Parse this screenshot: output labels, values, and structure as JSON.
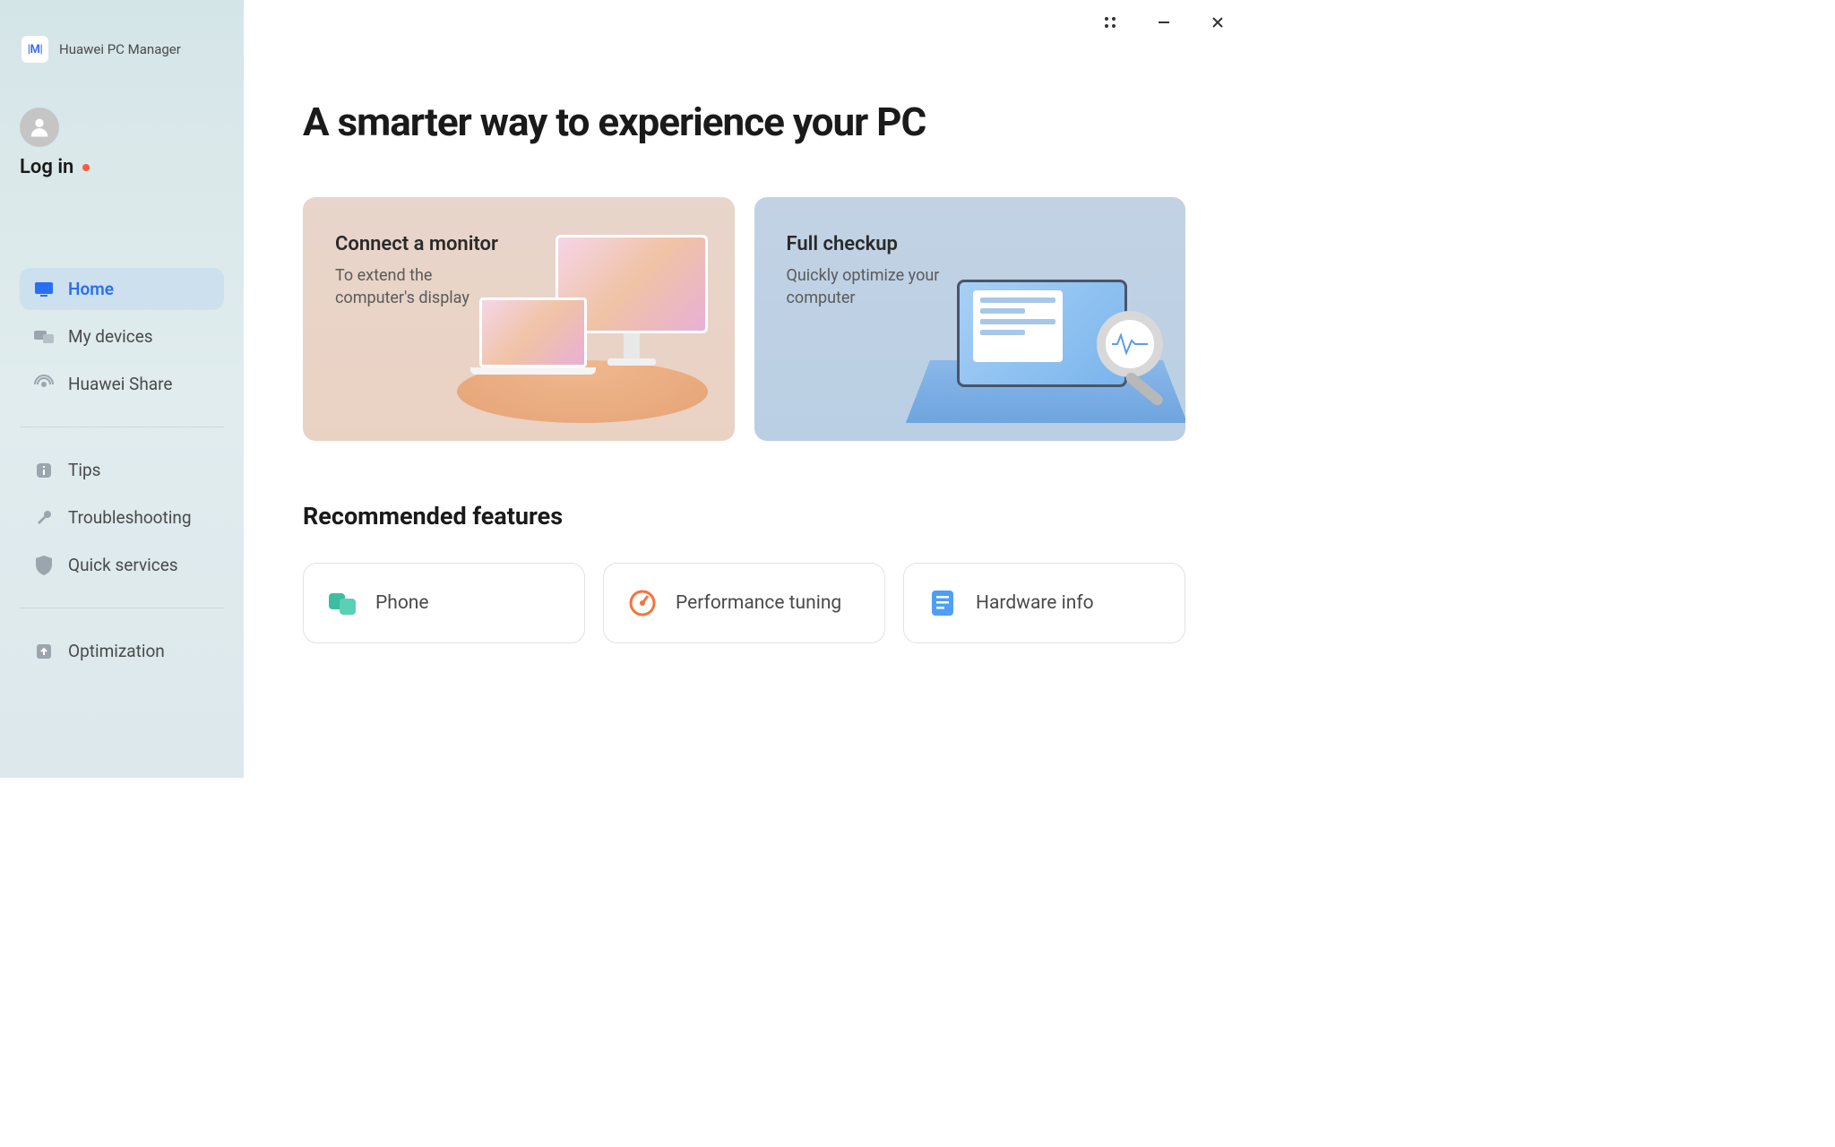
{
  "app": {
    "name": "Huawei PC Manager",
    "logo_text": "|M|"
  },
  "user": {
    "login_label": "Log in"
  },
  "sidebar": {
    "items_main": [
      {
        "label": "Home",
        "icon": "monitor-icon",
        "active": true
      },
      {
        "label": "My devices",
        "icon": "devices-icon",
        "active": false
      },
      {
        "label": "Huawei Share",
        "icon": "share-icon",
        "active": false
      }
    ],
    "items_support": [
      {
        "label": "Tips",
        "icon": "tips-icon"
      },
      {
        "label": "Troubleshooting",
        "icon": "wrench-icon"
      },
      {
        "label": "Quick services",
        "icon": "shield-icon"
      }
    ],
    "items_bottom": [
      {
        "label": "Optimization",
        "icon": "upload-icon"
      }
    ]
  },
  "main": {
    "page_title": "A smarter way to experience your PC",
    "cards": {
      "monitor": {
        "title": "Connect a monitor",
        "subtitle": "To extend the computer's display"
      },
      "checkup": {
        "title": "Full checkup",
        "subtitle": "Quickly optimize your computer"
      }
    },
    "recommended_title": "Recommended features",
    "features": [
      {
        "label": "Phone",
        "icon": "phone-icon",
        "color": "#3bbfa0"
      },
      {
        "label": "Performance tuning",
        "icon": "gauge-icon",
        "color": "#f5743c"
      },
      {
        "label": "Hardware info",
        "icon": "document-icon",
        "color": "#4d9ff5"
      }
    ]
  }
}
